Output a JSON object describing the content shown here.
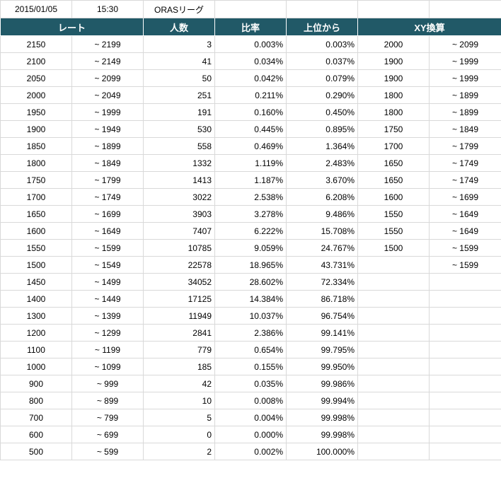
{
  "meta": {
    "date": "2015/01/05",
    "time": "15:30",
    "league": "ORASリーグ"
  },
  "headers": {
    "rate": "レート",
    "count": "人数",
    "ratio": "比率",
    "top": "上位から",
    "xy": "XY換算"
  },
  "rows": [
    {
      "low": "2150",
      "high": "~ 2199",
      "count": "3",
      "ratio": "0.003%",
      "top": "0.003%",
      "xy_low": "2000",
      "xy_high": "~ 2099"
    },
    {
      "low": "2100",
      "high": "~ 2149",
      "count": "41",
      "ratio": "0.034%",
      "top": "0.037%",
      "xy_low": "1900",
      "xy_high": "~ 1999"
    },
    {
      "low": "2050",
      "high": "~ 2099",
      "count": "50",
      "ratio": "0.042%",
      "top": "0.079%",
      "xy_low": "1900",
      "xy_high": "~ 1999"
    },
    {
      "low": "2000",
      "high": "~ 2049",
      "count": "251",
      "ratio": "0.211%",
      "top": "0.290%",
      "xy_low": "1800",
      "xy_high": "~ 1899"
    },
    {
      "low": "1950",
      "high": "~ 1999",
      "count": "191",
      "ratio": "0.160%",
      "top": "0.450%",
      "xy_low": "1800",
      "xy_high": "~ 1899"
    },
    {
      "low": "1900",
      "high": "~ 1949",
      "count": "530",
      "ratio": "0.445%",
      "top": "0.895%",
      "xy_low": "1750",
      "xy_high": "~ 1849"
    },
    {
      "low": "1850",
      "high": "~ 1899",
      "count": "558",
      "ratio": "0.469%",
      "top": "1.364%",
      "xy_low": "1700",
      "xy_high": "~ 1799"
    },
    {
      "low": "1800",
      "high": "~ 1849",
      "count": "1332",
      "ratio": "1.119%",
      "top": "2.483%",
      "xy_low": "1650",
      "xy_high": "~ 1749"
    },
    {
      "low": "1750",
      "high": "~ 1799",
      "count": "1413",
      "ratio": "1.187%",
      "top": "3.670%",
      "xy_low": "1650",
      "xy_high": "~ 1749"
    },
    {
      "low": "1700",
      "high": "~ 1749",
      "count": "3022",
      "ratio": "2.538%",
      "top": "6.208%",
      "xy_low": "1600",
      "xy_high": "~ 1699"
    },
    {
      "low": "1650",
      "high": "~ 1699",
      "count": "3903",
      "ratio": "3.278%",
      "top": "9.486%",
      "xy_low": "1550",
      "xy_high": "~ 1649"
    },
    {
      "low": "1600",
      "high": "~ 1649",
      "count": "7407",
      "ratio": "6.222%",
      "top": "15.708%",
      "xy_low": "1550",
      "xy_high": "~ 1649"
    },
    {
      "low": "1550",
      "high": "~ 1599",
      "count": "10785",
      "ratio": "9.059%",
      "top": "24.767%",
      "xy_low": "1500",
      "xy_high": "~ 1599"
    },
    {
      "low": "1500",
      "high": "~ 1549",
      "count": "22578",
      "ratio": "18.965%",
      "top": "43.731%",
      "xy_low": "",
      "xy_high": "~ 1599"
    },
    {
      "low": "1450",
      "high": "~ 1499",
      "count": "34052",
      "ratio": "28.602%",
      "top": "72.334%",
      "xy_low": "",
      "xy_high": ""
    },
    {
      "low": "1400",
      "high": "~ 1449",
      "count": "17125",
      "ratio": "14.384%",
      "top": "86.718%",
      "xy_low": "",
      "xy_high": ""
    },
    {
      "low": "1300",
      "high": "~ 1399",
      "count": "11949",
      "ratio": "10.037%",
      "top": "96.754%",
      "xy_low": "",
      "xy_high": ""
    },
    {
      "low": "1200",
      "high": "~ 1299",
      "count": "2841",
      "ratio": "2.386%",
      "top": "99.141%",
      "xy_low": "",
      "xy_high": ""
    },
    {
      "low": "1100",
      "high": "~ 1199",
      "count": "779",
      "ratio": "0.654%",
      "top": "99.795%",
      "xy_low": "",
      "xy_high": ""
    },
    {
      "low": "1000",
      "high": "~ 1099",
      "count": "185",
      "ratio": "0.155%",
      "top": "99.950%",
      "xy_low": "",
      "xy_high": ""
    },
    {
      "low": "900",
      "high": "~ 999",
      "count": "42",
      "ratio": "0.035%",
      "top": "99.986%",
      "xy_low": "",
      "xy_high": ""
    },
    {
      "low": "800",
      "high": "~ 899",
      "count": "10",
      "ratio": "0.008%",
      "top": "99.994%",
      "xy_low": "",
      "xy_high": ""
    },
    {
      "low": "700",
      "high": "~ 799",
      "count": "5",
      "ratio": "0.004%",
      "top": "99.998%",
      "xy_low": "",
      "xy_high": ""
    },
    {
      "low": "600",
      "high": "~ 699",
      "count": "0",
      "ratio": "0.000%",
      "top": "99.998%",
      "xy_low": "",
      "xy_high": ""
    },
    {
      "low": "500",
      "high": "~ 599",
      "count": "2",
      "ratio": "0.002%",
      "top": "100.000%",
      "xy_low": "",
      "xy_high": ""
    }
  ]
}
